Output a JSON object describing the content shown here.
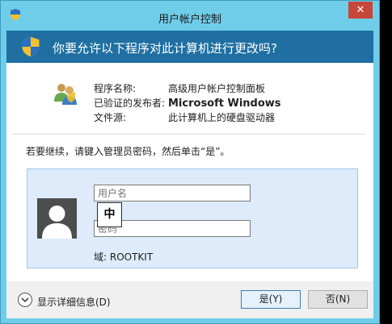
{
  "window": {
    "title": "用户帐户控制",
    "close_glyph": "✕",
    "question": "你要允许以下程序对此计算机进行更改吗?"
  },
  "info": {
    "program_label": "程序名称:",
    "program_value": "高级用户帐户控制面板",
    "publisher_label": "已验证的发布者:",
    "publisher_value": "Microsoft Windows",
    "source_label": "文件源:",
    "source_value": "此计算机上的硬盘驱动器"
  },
  "prompt": "若要继续，请键入管理员密码，然后单击“是”。",
  "credentials": {
    "username_placeholder": "用户名",
    "password_placeholder": "密码",
    "ime_indicator": "中",
    "domain": "域: ROOTKIT"
  },
  "footer": {
    "details_label": "显示详细信息(D)",
    "yes_label": "是(Y)",
    "no_label": "否(N)"
  },
  "icons": [
    "shield-icon",
    "users-icon",
    "user-avatar-icon",
    "chevron-down-icon",
    "close-icon"
  ]
}
